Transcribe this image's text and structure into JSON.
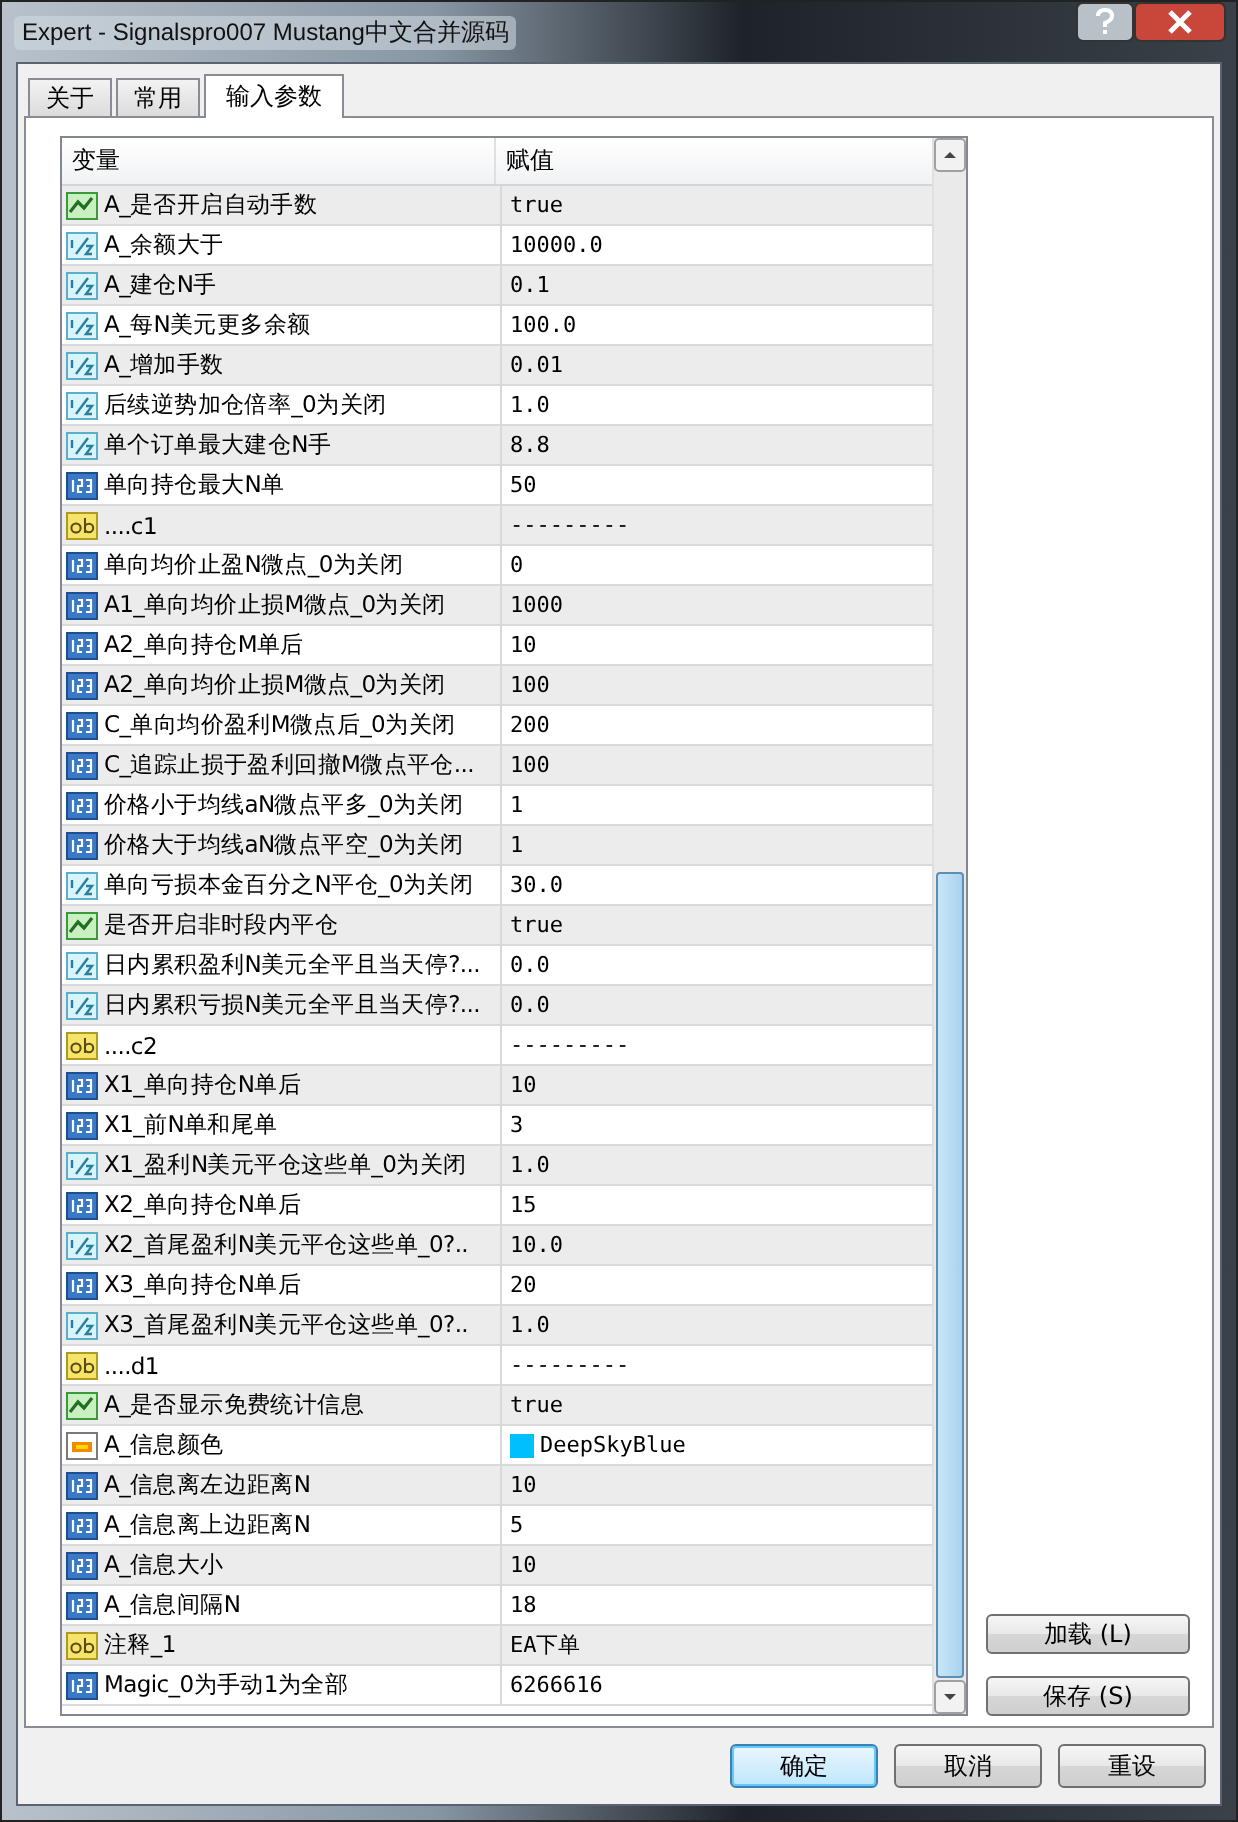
{
  "window": {
    "title": "Expert - Signalspro007 Mustang中文合并源码"
  },
  "tabs": [
    {
      "label": "关于",
      "selected": false
    },
    {
      "label": "常用",
      "selected": false
    },
    {
      "label": "输入参数",
      "selected": true
    }
  ],
  "table": {
    "columns": [
      "变量",
      "赋值"
    ],
    "rows": [
      {
        "kind": "bool",
        "name": "A_是否开启自动手数",
        "value": "true"
      },
      {
        "kind": "double",
        "name": "A_余额大于",
        "value": "10000.0"
      },
      {
        "kind": "double",
        "name": "A_建仓N手",
        "value": "0.1"
      },
      {
        "kind": "double",
        "name": "A_每N美元更多余额",
        "value": "100.0"
      },
      {
        "kind": "double",
        "name": "A_增加手数",
        "value": "0.01"
      },
      {
        "kind": "double",
        "name": "后续逆势加仓倍率_0为关闭",
        "value": "1.0"
      },
      {
        "kind": "double",
        "name": "单个订单最大建仓N手",
        "value": "8.8"
      },
      {
        "kind": "int",
        "name": "单向持仓最大N单",
        "value": "50"
      },
      {
        "kind": "string",
        "name": "....c1",
        "value": "---------"
      },
      {
        "kind": "int",
        "name": "单向均价止盈N微点_0为关闭",
        "value": "0"
      },
      {
        "kind": "int",
        "name": "A1_单向均价止损M微点_0为关闭",
        "value": "1000"
      },
      {
        "kind": "int",
        "name": "A2_单向持仓M单后",
        "value": "10"
      },
      {
        "kind": "int",
        "name": "A2_单向均价止损M微点_0为关闭",
        "value": "100"
      },
      {
        "kind": "int",
        "name": "C_单向均价盈利M微点后_0为关闭",
        "value": "200"
      },
      {
        "kind": "int",
        "name": "C_追踪止损于盈利回撤M微点平仓...",
        "value": "100"
      },
      {
        "kind": "int",
        "name": "价格小于均线aN微点平多_0为关闭",
        "value": "1"
      },
      {
        "kind": "int",
        "name": "价格大于均线aN微点平空_0为关闭",
        "value": "1"
      },
      {
        "kind": "double",
        "name": "单向亏损本金百分之N平仓_0为关闭",
        "value": "30.0"
      },
      {
        "kind": "bool",
        "name": "是否开启非时段内平仓",
        "value": "true"
      },
      {
        "kind": "double",
        "name": "日内累积盈利N美元全平且当天停?...",
        "value": "0.0"
      },
      {
        "kind": "double",
        "name": "日内累积亏损N美元全平且当天停?...",
        "value": "0.0"
      },
      {
        "kind": "string",
        "name": "....c2",
        "value": "---------"
      },
      {
        "kind": "int",
        "name": "X1_单向持仓N单后",
        "value": "10"
      },
      {
        "kind": "int",
        "name": "X1_前N单和尾单",
        "value": "3"
      },
      {
        "kind": "double",
        "name": "X1_盈利N美元平仓这些单_0为关闭",
        "value": "1.0"
      },
      {
        "kind": "int",
        "name": "X2_单向持仓N单后",
        "value": "15"
      },
      {
        "kind": "double",
        "name": "X2_首尾盈利N美元平仓这些单_0?..",
        "value": "10.0"
      },
      {
        "kind": "int",
        "name": "X3_单向持仓N单后",
        "value": "20"
      },
      {
        "kind": "double",
        "name": "X3_首尾盈利N美元平仓这些单_0?..",
        "value": "1.0"
      },
      {
        "kind": "string",
        "name": "....d1",
        "value": "---------"
      },
      {
        "kind": "bool",
        "name": "A_是否显示免费统计信息",
        "value": "true"
      },
      {
        "kind": "color",
        "name": "A_信息颜色",
        "value": "DeepSkyBlue",
        "color": "#00bfff"
      },
      {
        "kind": "int",
        "name": "A_信息离左边距离N",
        "value": "10"
      },
      {
        "kind": "int",
        "name": "A_信息离上边距离N",
        "value": "5"
      },
      {
        "kind": "int",
        "name": "A_信息大小",
        "value": "10"
      },
      {
        "kind": "int",
        "name": "A_信息间隔N",
        "value": "18"
      },
      {
        "kind": "string",
        "name": "注释_1",
        "value": "EA下单"
      },
      {
        "kind": "int",
        "name": "Magic_0为手动1为全部",
        "value": "6266616"
      }
    ]
  },
  "side_buttons": [
    "加载 (L)",
    "保存 (S)"
  ],
  "buttons": [
    {
      "label": "确定",
      "default": true
    },
    {
      "label": "取消",
      "default": false
    },
    {
      "label": "重设",
      "default": false
    }
  ]
}
